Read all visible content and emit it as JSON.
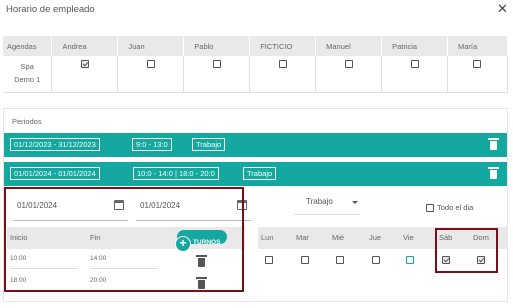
{
  "dialog": {
    "title": "Horario de empleado"
  },
  "agendas": {
    "header_label": "Agendas",
    "employees": [
      "Andrea",
      "Juan",
      "Pablo",
      "FICTICIO",
      "Manuel",
      "Patricia",
      "María"
    ],
    "row_label_line1": "Spa",
    "row_label_line2": "Demo 1",
    "checked": [
      true,
      false,
      false,
      false,
      false,
      false,
      false
    ]
  },
  "periods": {
    "label": "Periodos",
    "items": [
      {
        "dates": "01/12/2023 - 31/12/2023",
        "hours": "9:0 - 13:0",
        "type": "Trabajo"
      },
      {
        "dates": "01/01/2024 - 01/01/2024",
        "hours": "10:0 - 14:0 | 18:0 - 20:0",
        "type": "Trabajo"
      }
    ]
  },
  "editor": {
    "start_date": "01/01/2024",
    "end_date": "01/01/2024",
    "type_select": "Trabajo",
    "all_day_label": "Todo el dia",
    "shifts": {
      "col_start": "Inicio",
      "col_end": "Fin",
      "add_label": "TURNOS",
      "rows": [
        {
          "start": "10:00",
          "end": "14:00"
        },
        {
          "start": "18:00",
          "end": "20:00"
        }
      ]
    },
    "days": {
      "labels": [
        "Lun",
        "Mar",
        "Mié",
        "Jue",
        "Vie",
        "Sáb",
        "Dom"
      ],
      "checked": [
        false,
        false,
        false,
        false,
        false,
        true,
        true
      ]
    }
  },
  "colors": {
    "accent": "#14a8a0",
    "highlight": "#7a0f17",
    "header_bg": "#e9e9e9"
  }
}
